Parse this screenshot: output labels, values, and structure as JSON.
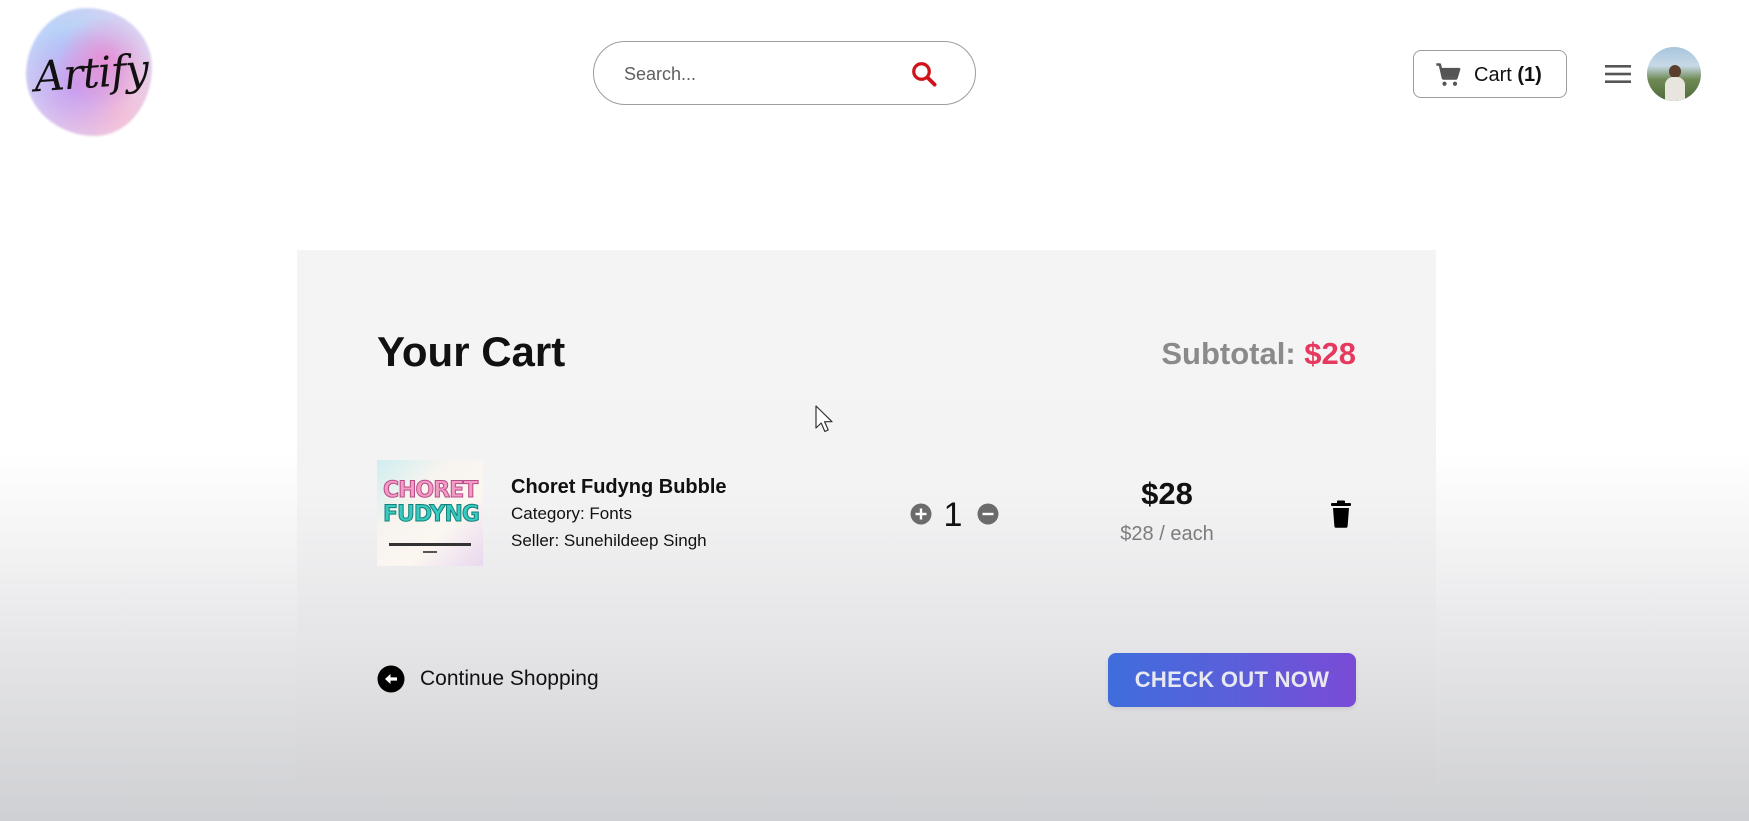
{
  "header": {
    "logo_text": "Artify",
    "search": {
      "placeholder": "Search..."
    },
    "cart": {
      "label": "Cart",
      "count": "(1)"
    },
    "icons": {
      "search": "search-icon",
      "cart": "cart-icon",
      "menu": "menu-icon",
      "avatar": "user-avatar"
    }
  },
  "cart_page": {
    "title": "Your Cart",
    "subtotal_label": "Subtotal:",
    "subtotal_value": "$28",
    "items": [
      {
        "name": "Choret Fudyng Bubble",
        "category": "Category: Fonts",
        "seller": "Seller: Sunehildeep Singh",
        "quantity": "1",
        "price": "$28",
        "unit_price": "$28 / each",
        "thumbnail_text": [
          "CHORET",
          "FUDYNG"
        ]
      }
    ],
    "continue_label": "Continue Shopping",
    "checkout_label": "CHECK OUT NOW"
  },
  "colors": {
    "accent_price": "#e5395d",
    "checkout_gradient_start": "#3f6ddc",
    "checkout_gradient_end": "#7a4bd6",
    "search_icon": "#d0121b"
  }
}
